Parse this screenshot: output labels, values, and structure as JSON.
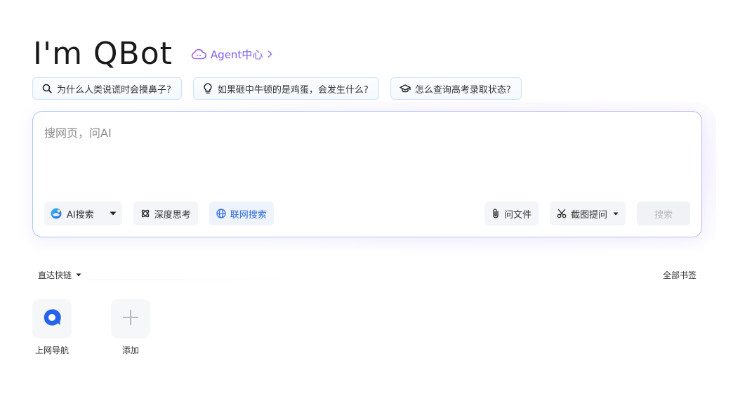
{
  "header": {
    "title": "I'm QBot",
    "agent_link": "Agent中心"
  },
  "suggestions": [
    {
      "icon": "search-icon",
      "text": "为什么人类说谎时会摸鼻子?"
    },
    {
      "icon": "lightbulb-icon",
      "text": "如果砸中牛顿的是鸡蛋，会发生什么?"
    },
    {
      "icon": "graduation-cap-icon",
      "text": "怎么查询高考录取状态?"
    }
  ],
  "search": {
    "placeholder": "搜网页，问AI",
    "value": "",
    "tools_left": {
      "ai_search": "AI搜索",
      "deep_think": "深度思考",
      "web_search": "联网搜索"
    },
    "tools_right": {
      "ask_file": "问文件",
      "screenshot_ask": "截图提问",
      "submit": "搜索"
    }
  },
  "quick_links": {
    "header": "直达快链",
    "all_bookmarks": "全部书签",
    "items": [
      {
        "icon": "qbot-logo-icon",
        "label": "上网导航"
      },
      {
        "icon": "plus-icon",
        "label": "添加"
      }
    ]
  },
  "colors": {
    "accent_purple": "#8e6cf0",
    "web_search_blue": "#2f6be0",
    "logo_blue": "#2563eb",
    "chip_border": "#cfe1f5"
  }
}
